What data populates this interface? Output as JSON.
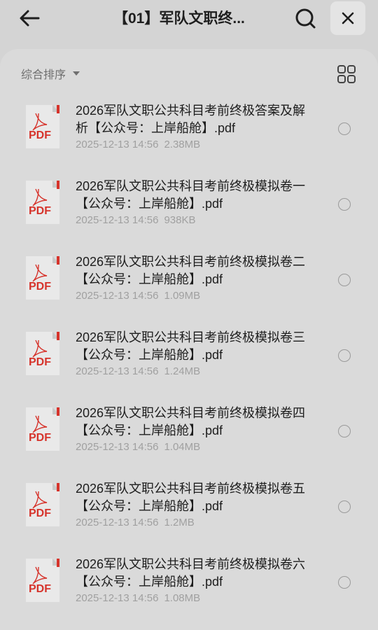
{
  "header": {
    "title": "【01】军队文职终...",
    "back_icon": "back-arrow-icon",
    "search_icon": "search-icon",
    "close_icon": "close-icon"
  },
  "toolbar": {
    "sort_label": "综合排序",
    "view_icon": "grid-view-icon"
  },
  "colors": {
    "pdf_red": "#d6332b",
    "background": "#d4d4d4",
    "panel": "#dadada"
  },
  "files": [
    {
      "icon": "pdf-file-icon",
      "badge": "PDF",
      "name": "2026军队文职公共科目考前终极答案及解析【公众号：上岸船舱】.pdf",
      "date": "2025-12-13 14:56",
      "size": "2.38MB"
    },
    {
      "icon": "pdf-file-icon",
      "badge": "PDF",
      "name": "2026军队文职公共科目考前终极模拟卷一【公众号：上岸船舱】.pdf",
      "date": "2025-12-13 14:56",
      "size": "938KB"
    },
    {
      "icon": "pdf-file-icon",
      "badge": "PDF",
      "name": "2026军队文职公共科目考前终极模拟卷二【公众号：上岸船舱】.pdf",
      "date": "2025-12-13 14:56",
      "size": "1.09MB"
    },
    {
      "icon": "pdf-file-icon",
      "badge": "PDF",
      "name": "2026军队文职公共科目考前终极模拟卷三【公众号：上岸船舱】.pdf",
      "date": "2025-12-13 14:56",
      "size": "1.24MB"
    },
    {
      "icon": "pdf-file-icon",
      "badge": "PDF",
      "name": "2026军队文职公共科目考前终极模拟卷四【公众号：上岸船舱】.pdf",
      "date": "2025-12-13 14:56",
      "size": "1.04MB"
    },
    {
      "icon": "pdf-file-icon",
      "badge": "PDF",
      "name": "2026军队文职公共科目考前终极模拟卷五【公众号：上岸船舱】.pdf",
      "date": "2025-12-13 14:56",
      "size": "1.2MB"
    },
    {
      "icon": "pdf-file-icon",
      "badge": "PDF",
      "name": "2026军队文职公共科目考前终极模拟卷六【公众号：上岸船舱】.pdf",
      "date": "2025-12-13 14:56",
      "size": "1.08MB"
    }
  ]
}
